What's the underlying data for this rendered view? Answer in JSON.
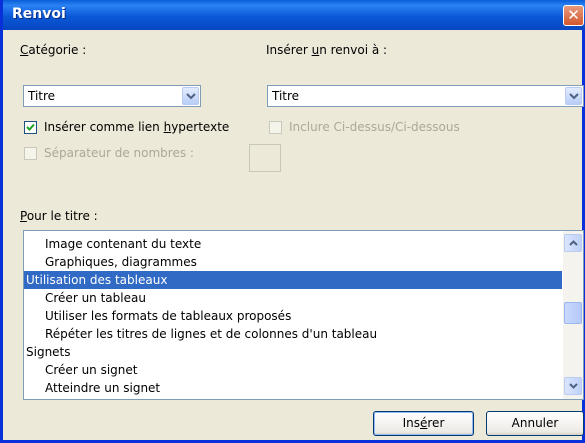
{
  "window": {
    "title": "Renvoi",
    "close_label": "✕"
  },
  "category": {
    "label_key": "C",
    "label_rest": "atégorie :",
    "value": "Titre"
  },
  "insert_ref": {
    "label_pre": "Insérer ",
    "label_key": "u",
    "label_rest": "n renvoi à :",
    "value": "Titre"
  },
  "hyperlink": {
    "checked": true,
    "label_pre": "Insérer comme lien ",
    "label_key": "h",
    "label_rest": "ypertexte"
  },
  "include_above_below": {
    "checked": false,
    "enabled": false,
    "label": "Inclure Ci-dessus/Ci-dessous"
  },
  "number_separator": {
    "checked": false,
    "enabled": false,
    "label": "Séparateur de nombres :",
    "value": ""
  },
  "for_title": {
    "label_key": "P",
    "label_rest": "our le titre :"
  },
  "list": {
    "items": [
      {
        "text": "Image contenant du texte",
        "indent": 1,
        "selected": false
      },
      {
        "text": "Graphiques, diagrammes",
        "indent": 1,
        "selected": false
      },
      {
        "text": "Utilisation des tableaux",
        "indent": 0,
        "selected": true
      },
      {
        "text": "Créer un tableau",
        "indent": 1,
        "selected": false
      },
      {
        "text": "Utiliser les formats de tableaux proposés",
        "indent": 1,
        "selected": false
      },
      {
        "text": "Répéter les titres de lignes et de colonnes d'un tableau",
        "indent": 1,
        "selected": false
      },
      {
        "text": "Signets",
        "indent": 0,
        "selected": false
      },
      {
        "text": "Créer un signet",
        "indent": 1,
        "selected": false
      },
      {
        "text": "Atteindre un signet",
        "indent": 1,
        "selected": false
      }
    ]
  },
  "buttons": {
    "insert": {
      "pre": "Ins",
      "key": "é",
      "post": "rer"
    },
    "cancel": "Annuler"
  }
}
